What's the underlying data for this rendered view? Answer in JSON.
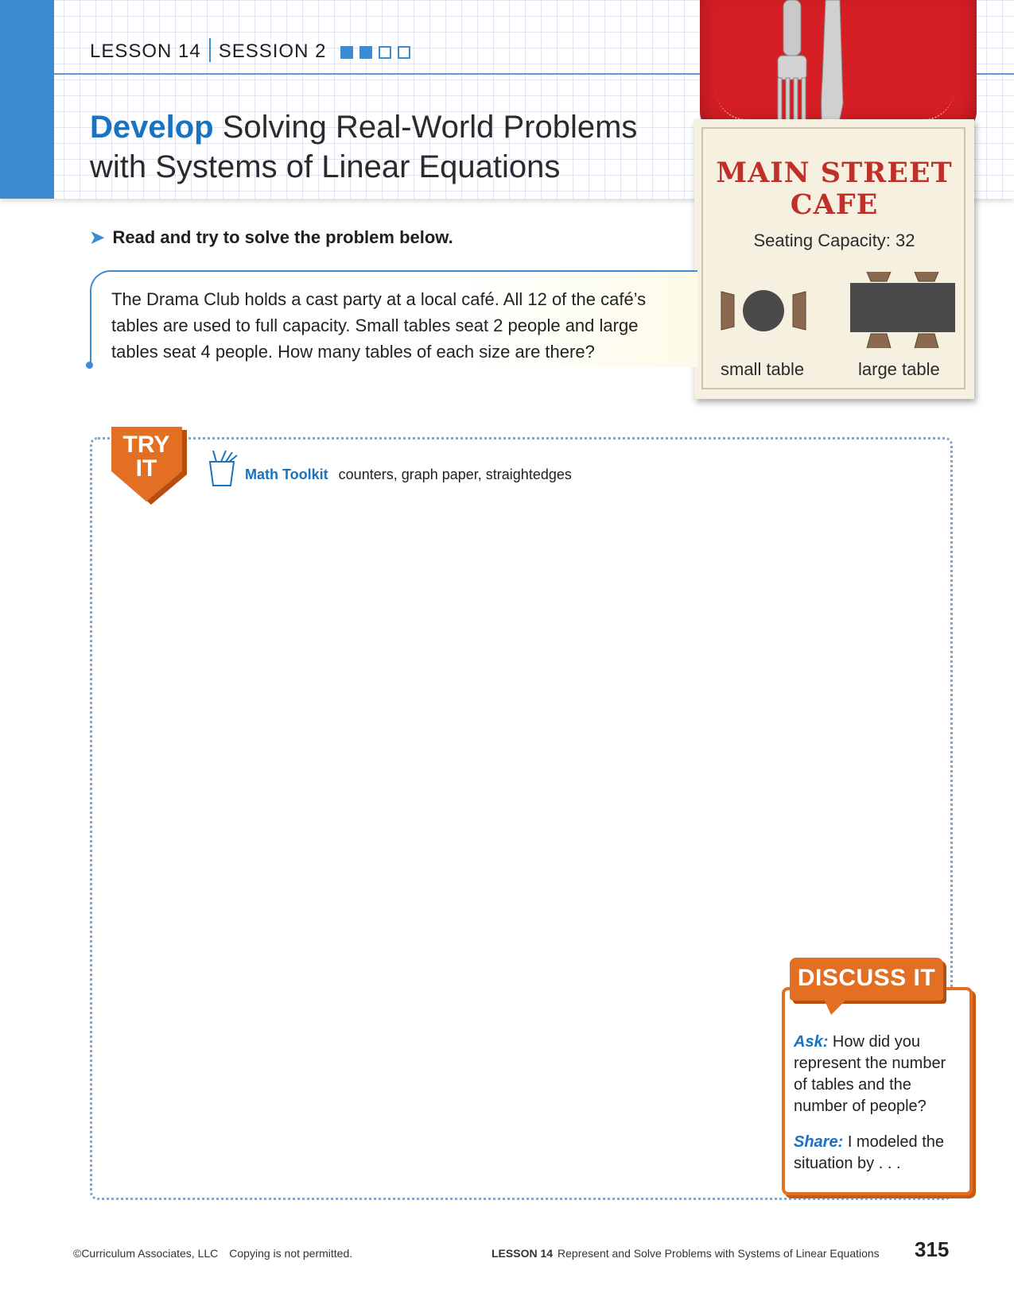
{
  "header": {
    "lesson": "LESSON 14",
    "session": "SESSION 2",
    "progress_filled": 2,
    "progress_total": 4,
    "title_keyword": "Develop",
    "title_line1": "Solving Real-World Problems",
    "title_line2": "with Systems of Linear Equations"
  },
  "instruction": "Read and try to solve the problem below.",
  "problem": {
    "line1": "The Drama Club holds a cast party at a local café. All 12 of the café’s",
    "line2": "tables are used to full capacity. Small tables seat 2 people and large",
    "line3": "tables seat 4 people. How many tables of each size are there?"
  },
  "sign": {
    "title_line1": "MAIN STREET",
    "title_line2": "CAFE",
    "seating": "Seating Capacity: 32",
    "small_label": "small table",
    "large_label": "large table"
  },
  "try_it": {
    "badge_line1": "TRY",
    "badge_line2": "IT",
    "toolkit_label": "Math Toolkit",
    "toolkit_items": "counters, graph paper, straightedges"
  },
  "discuss": {
    "title": "DISCUSS IT",
    "ask_label": "Ask:",
    "ask_text_1": "How did you",
    "ask_text_2": "represent the number",
    "ask_text_3": "of tables and the",
    "ask_text_4": "number of people?",
    "share_label": "Share:",
    "share_text_1": "I modeled the",
    "share_text_2": "situation by . . ."
  },
  "footer": {
    "copyright": "©Curriculum Associates, LLC",
    "notice": "Copying is not permitted.",
    "lesson": "LESSON 14",
    "lesson_title": "Represent and Solve Problems with Systems of Linear Equations",
    "page_number": "315"
  },
  "colors": {
    "accent_blue": "#3d8bd0",
    "title_blue": "#1a73bf",
    "orange": "#e36f22",
    "sign_red": "#c0302a",
    "napkin_red": "#d61e25"
  }
}
